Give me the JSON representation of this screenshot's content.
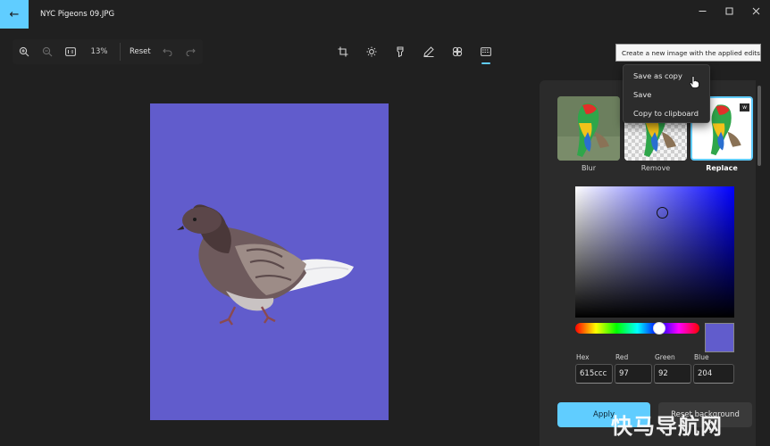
{
  "window": {
    "title": "NYC Pigeons 09.JPG"
  },
  "toolbar": {
    "zoom_level": "13%",
    "reset_label": "Reset"
  },
  "background_panel": {
    "options": [
      {
        "label": "Blur",
        "selected": false
      },
      {
        "label": "Remove",
        "selected": false
      },
      {
        "label": "Replace",
        "selected": true
      }
    ],
    "color": {
      "hex": "615ccc",
      "red": "97",
      "green": "92",
      "blue": "204",
      "swatch": "#615ccc"
    },
    "field_labels": {
      "hex": "Hex",
      "red": "Red",
      "green": "Green",
      "blue": "Blue"
    },
    "apply_label": "Apply",
    "reset_background_label": "Reset background",
    "thumb_badge": "w"
  },
  "save_menu": {
    "tooltip": "Create a new image with the applied edits",
    "items": [
      "Save as copy",
      "Save",
      "Copy to clipboard"
    ]
  },
  "watermark": "快马导航网",
  "colors": {
    "accent": "#60cdff",
    "canvas_bg": "#615ccc"
  }
}
